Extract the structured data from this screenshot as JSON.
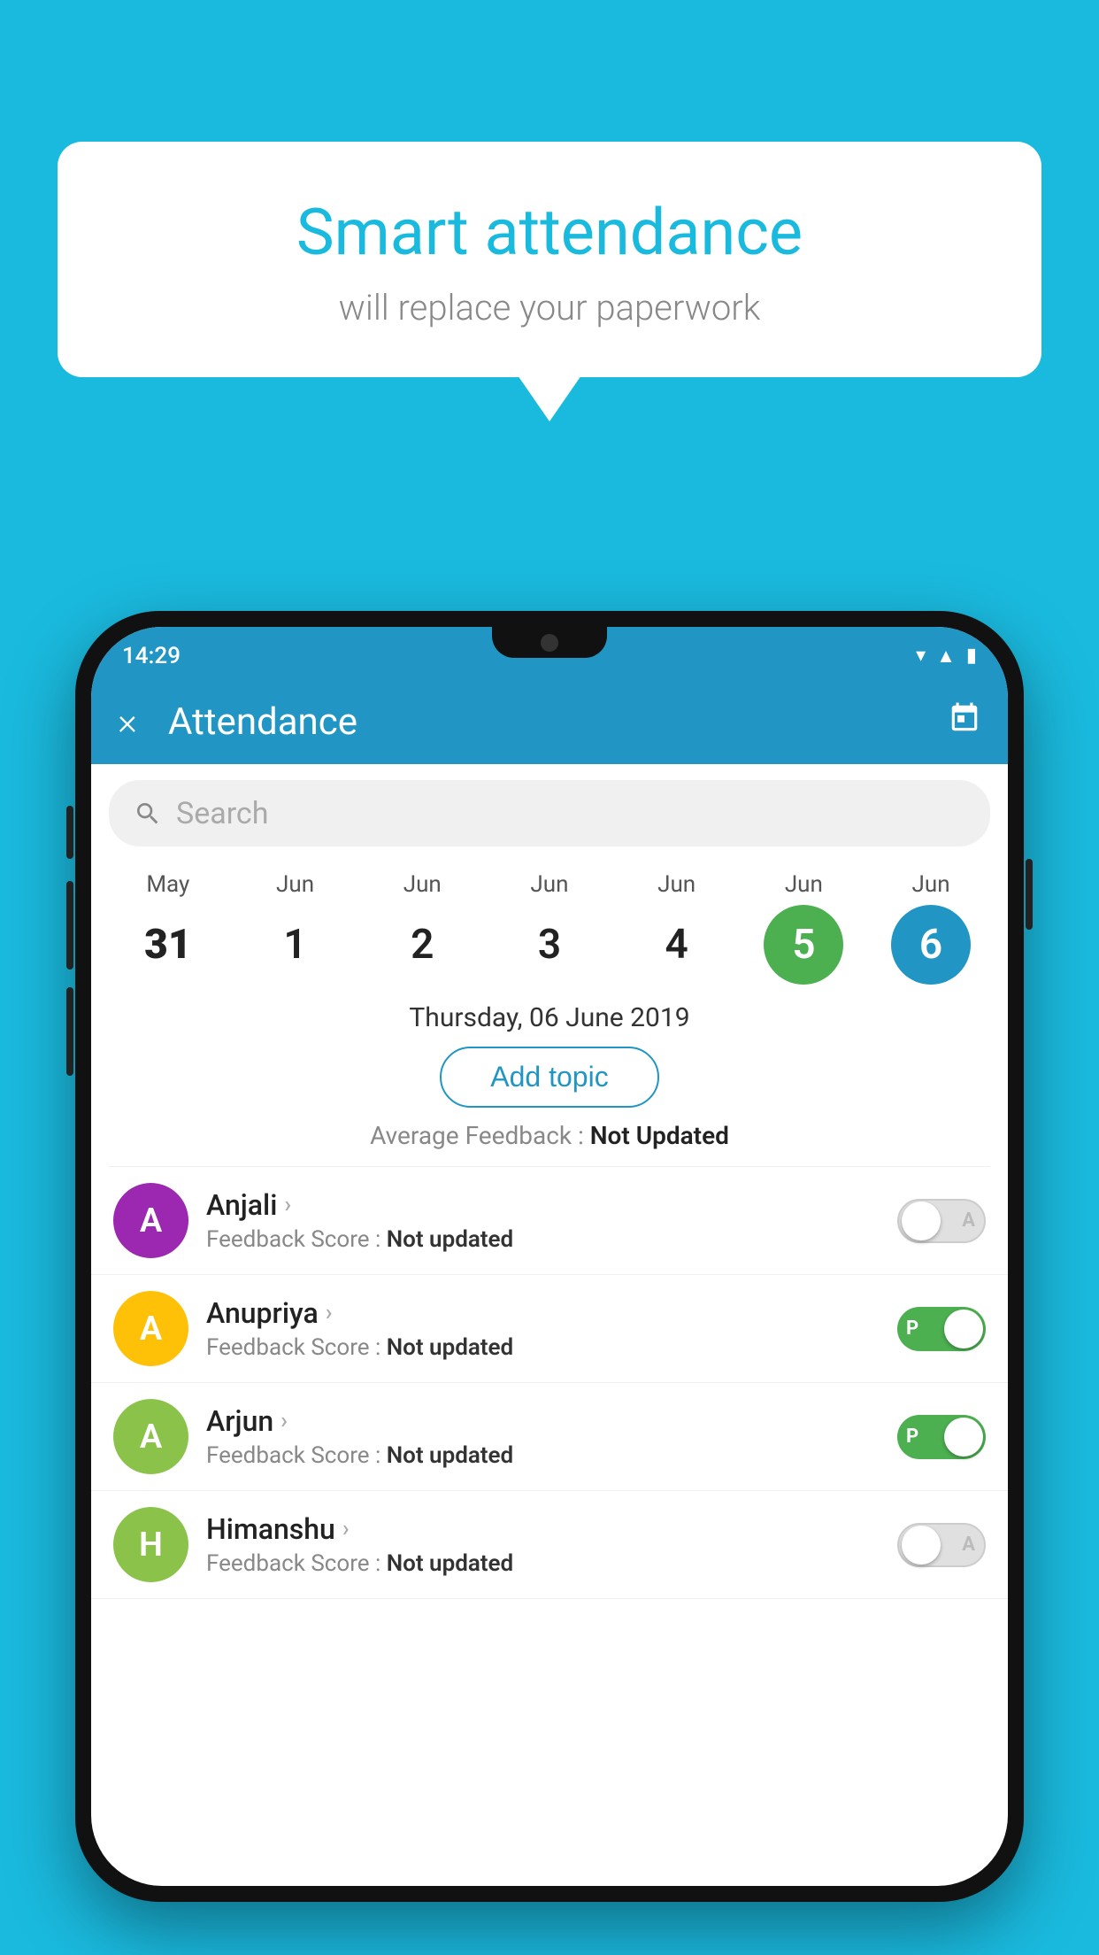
{
  "background_color": "#1ABADF",
  "speech_bubble": {
    "title": "Smart attendance",
    "subtitle": "will replace your paperwork"
  },
  "status_bar": {
    "time": "14:29",
    "icons": [
      "wifi",
      "signal",
      "battery"
    ]
  },
  "app_bar": {
    "title": "Attendance",
    "close_label": "×",
    "calendar_label": "📅"
  },
  "search": {
    "placeholder": "Search"
  },
  "calendar": {
    "days": [
      {
        "month": "May",
        "day": "31",
        "state": "normal"
      },
      {
        "month": "Jun",
        "day": "1",
        "state": "normal"
      },
      {
        "month": "Jun",
        "day": "2",
        "state": "normal"
      },
      {
        "month": "Jun",
        "day": "3",
        "state": "normal"
      },
      {
        "month": "Jun",
        "day": "4",
        "state": "normal"
      },
      {
        "month": "Jun",
        "day": "5",
        "state": "today"
      },
      {
        "month": "Jun",
        "day": "6",
        "state": "selected"
      }
    ]
  },
  "selected_date": "Thursday, 06 June 2019",
  "add_topic_label": "Add topic",
  "avg_feedback": {
    "label": "Average Feedback : ",
    "value": "Not Updated"
  },
  "students": [
    {
      "name": "Anjali",
      "avatar_letter": "A",
      "avatar_color": "#9C27B0",
      "feedback_label": "Feedback Score : ",
      "feedback_value": "Not updated",
      "toggle": "off",
      "toggle_label": "A"
    },
    {
      "name": "Anupriya",
      "avatar_letter": "A",
      "avatar_color": "#FFC107",
      "feedback_label": "Feedback Score : ",
      "feedback_value": "Not updated",
      "toggle": "on",
      "toggle_label": "P"
    },
    {
      "name": "Arjun",
      "avatar_letter": "A",
      "avatar_color": "#8BC34A",
      "feedback_label": "Feedback Score : ",
      "feedback_value": "Not updated",
      "toggle": "on",
      "toggle_label": "P"
    },
    {
      "name": "Himanshu",
      "avatar_letter": "H",
      "avatar_color": "#8BC34A",
      "feedback_label": "Feedback Score : ",
      "feedback_value": "Not updated",
      "toggle": "off",
      "toggle_label": "A"
    }
  ]
}
